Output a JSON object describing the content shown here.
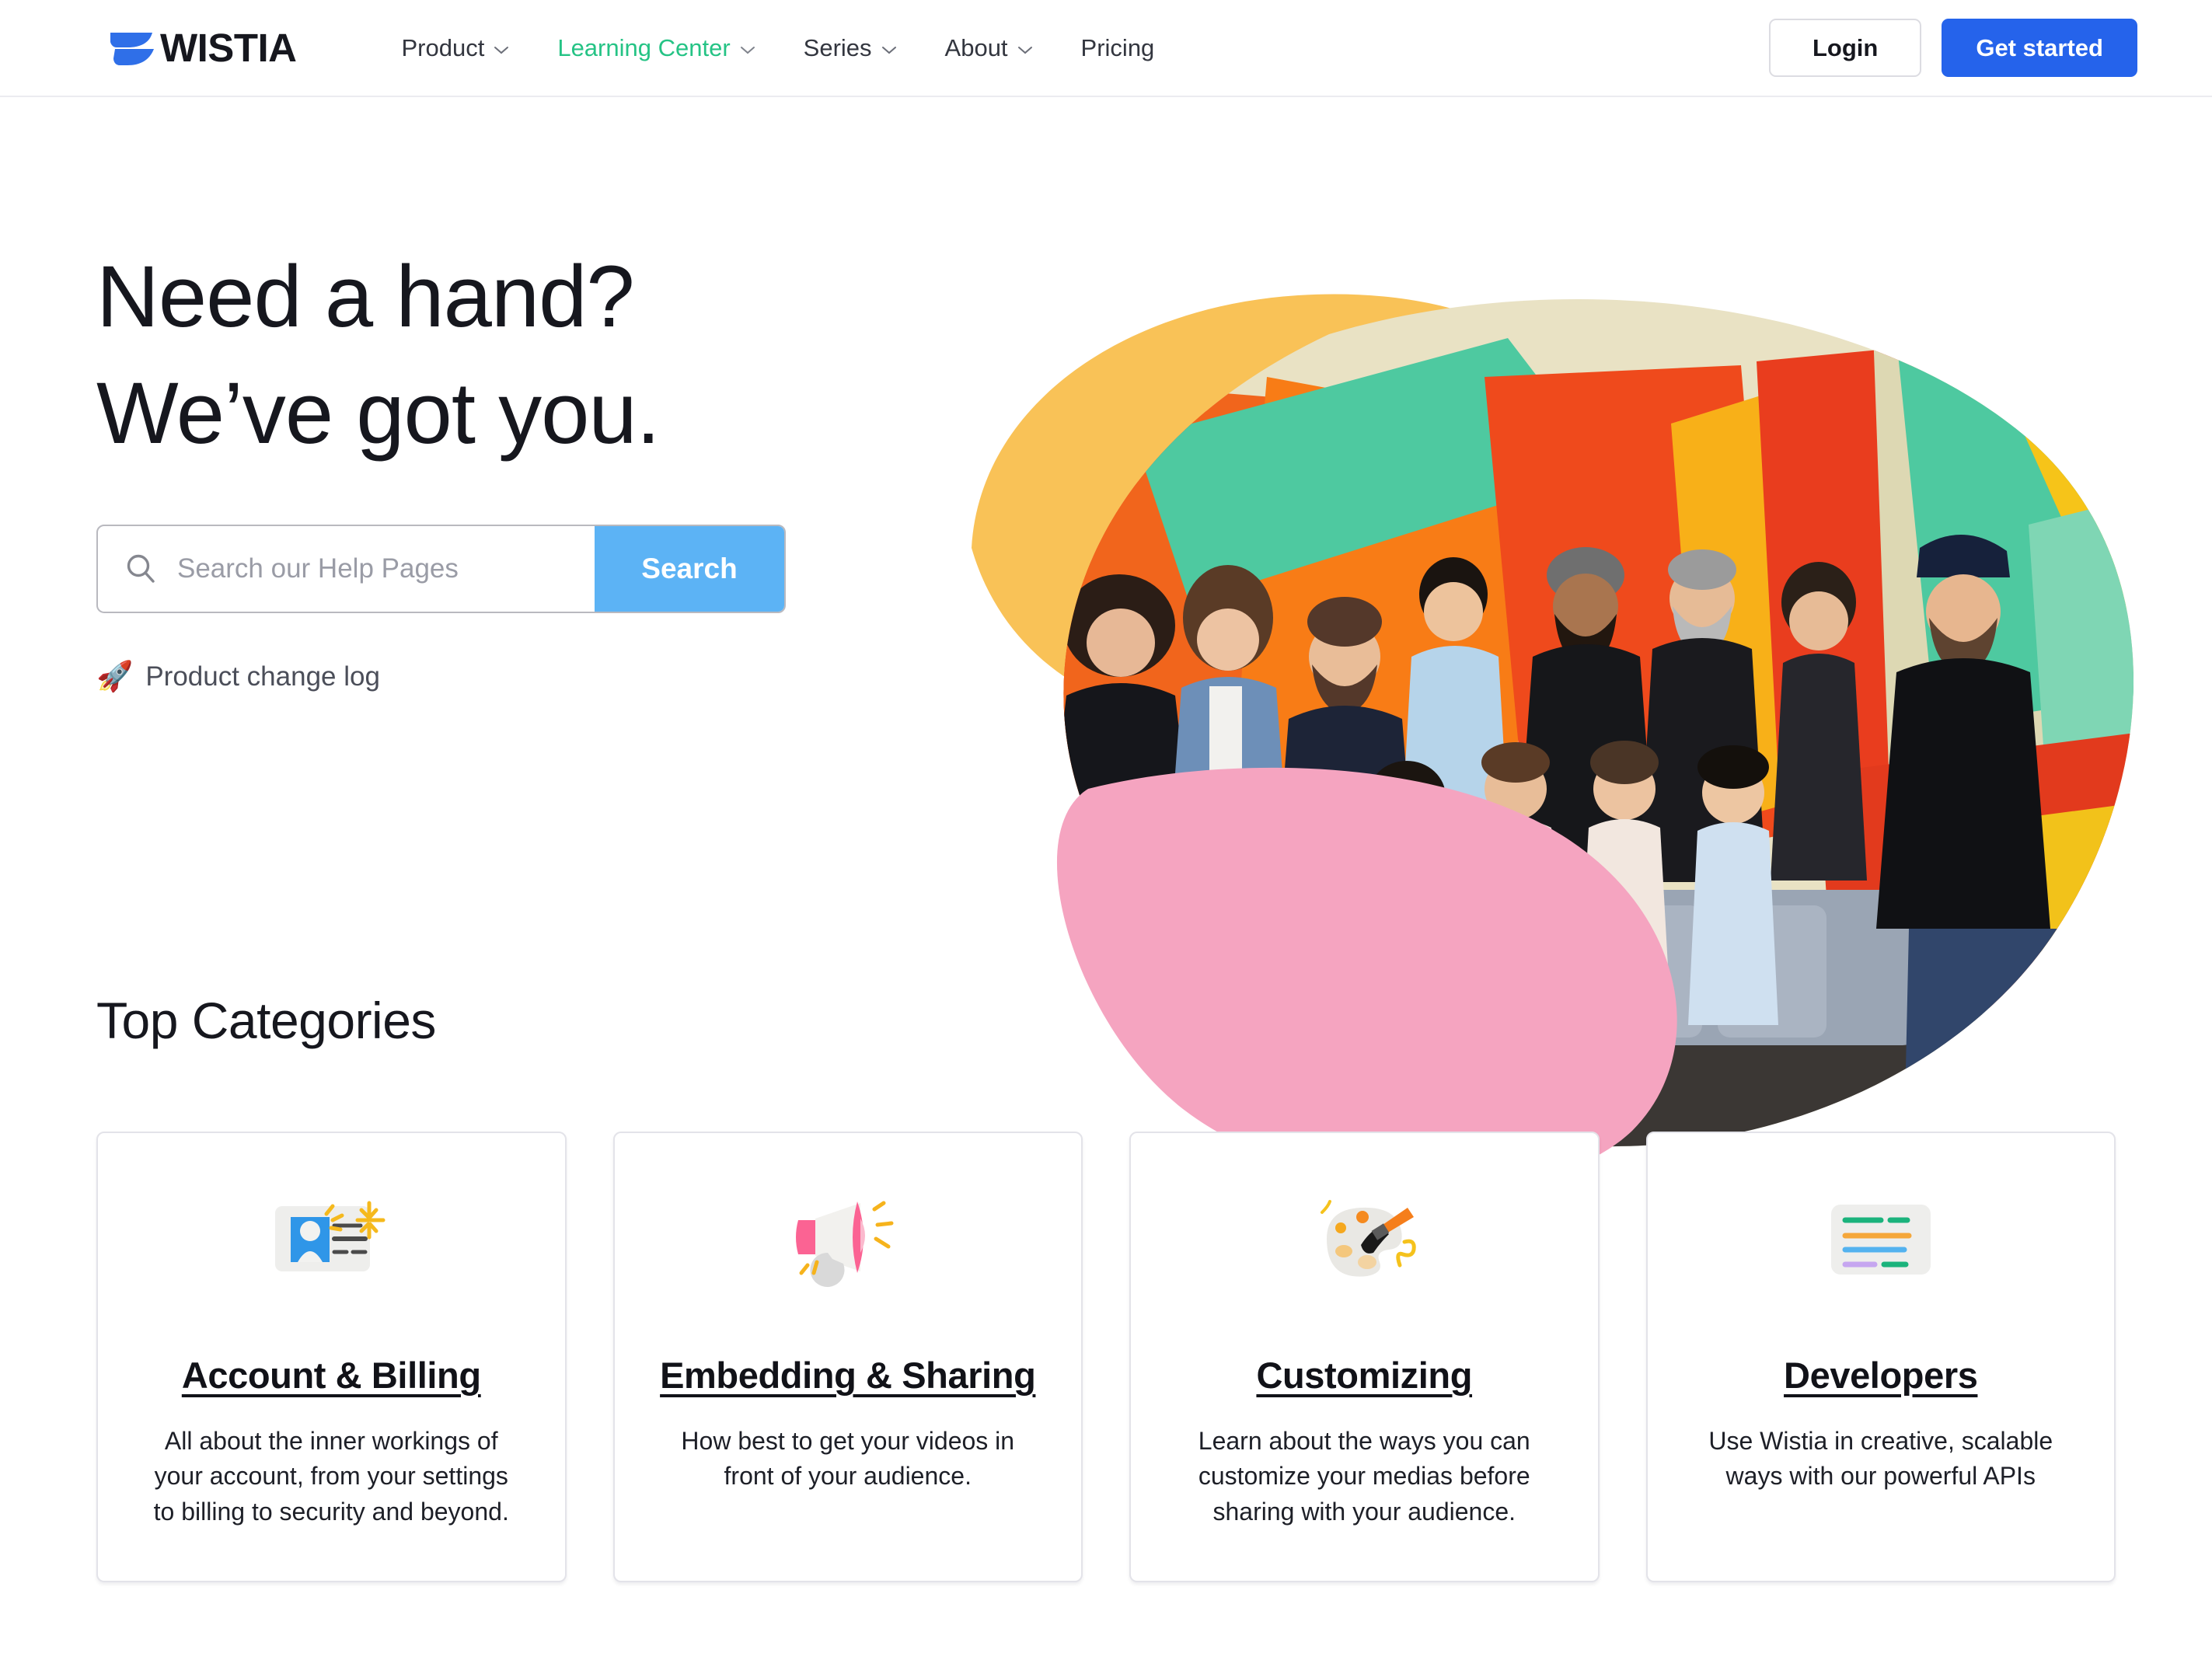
{
  "brand": {
    "name": "WISTIA",
    "logo_icon": "wistia-swoosh-logo",
    "color": "#2563eb"
  },
  "nav": {
    "links": [
      {
        "label": "Product",
        "has_dropdown": true,
        "active": false
      },
      {
        "label": "Learning Center",
        "has_dropdown": true,
        "active": true
      },
      {
        "label": "Series",
        "has_dropdown": true,
        "active": false
      },
      {
        "label": "About",
        "has_dropdown": true,
        "active": false
      },
      {
        "label": "Pricing",
        "has_dropdown": false,
        "active": false
      }
    ],
    "active_color": "#25c385",
    "login_label": "Login",
    "get_started_label": "Get started",
    "get_started_color": "#2563eb"
  },
  "hero": {
    "title_line1": "Need a hand?",
    "title_line2": "We’ve got you.",
    "search": {
      "placeholder": "Search our Help Pages",
      "value": "",
      "button_label": "Search",
      "button_color": "#5cb3f5",
      "icon": "search-icon"
    },
    "changelog": {
      "emoji": "🚀",
      "label": "Product change log"
    },
    "art": {
      "description": "Wistia team group photo masked into a blob shape, with a yellow blob behind and a pink blob in front",
      "yellow_blob_color": "#f9c257",
      "pink_blob_color": "#f5a4c0"
    }
  },
  "categories": {
    "heading": "Top Categories",
    "cards": [
      {
        "icon": "id-card-icon",
        "title": "Account & Billing",
        "description": "All about the inner workings of your account, from your settings to billing to security and beyond."
      },
      {
        "icon": "megaphone-icon",
        "title": "Embedding & Sharing",
        "description": "How best to get your videos in front of your audience."
      },
      {
        "icon": "paint-palette-icon",
        "title": "Customizing",
        "description": "Learn about the ways you can customize your medias before sharing with your audience."
      },
      {
        "icon": "code-lines-icon",
        "title": "Developers",
        "description": "Use Wistia in creative, scalable ways with our powerful APIs"
      }
    ]
  }
}
